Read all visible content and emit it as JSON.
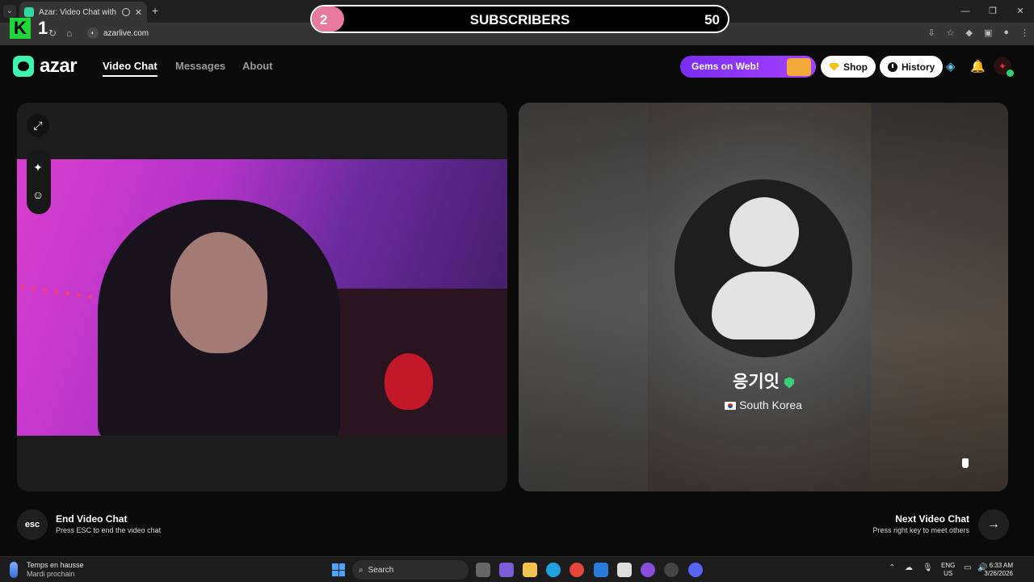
{
  "browser": {
    "tab_title": "Azar: Video Chat with New",
    "tab_close": "✕",
    "new_tab": "+",
    "url": "azarlive.com",
    "window_controls": [
      "—",
      "❐",
      "✕"
    ]
  },
  "overlay": {
    "channel_letter": "K",
    "channel_number": "1",
    "subscriber_current": "2",
    "subscriber_label": "SUBSCRIBERS",
    "subscriber_goal": "50",
    "subscriber_progress": 0.04
  },
  "header": {
    "logo_text": "azar",
    "nav": [
      "Video Chat",
      "Messages",
      "About"
    ],
    "promo_text": "Gems on Web!",
    "shop_label": "Shop",
    "history_label": "History",
    "colors": {
      "accent": "#3ff2b0",
      "promo": "#8a35f7"
    }
  },
  "partner": {
    "name": "응기잇",
    "country": "South Korea"
  },
  "footer": {
    "esc_key": "esc",
    "end_title": "End Video Chat",
    "end_sub": "Press ESC to end the video chat",
    "next_title": "Next Video Chat",
    "next_sub": "Press right key to meet others"
  },
  "taskbar": {
    "weather_title": "Temps en hausse",
    "weather_sub": "Mardi prochain",
    "search_label": "Search",
    "lang_1": "ENG",
    "lang_2": "US",
    "time": "6:33 AM",
    "date": "3/26/2026"
  }
}
